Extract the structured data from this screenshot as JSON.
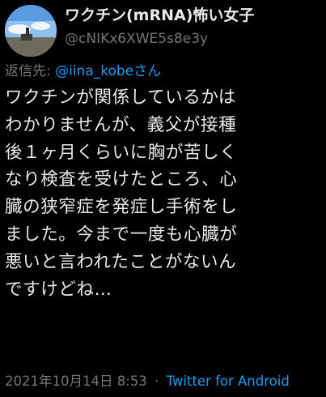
{
  "user": {
    "display_name": "ワクチン(mRNA)怖い女子",
    "handle": "@cNIKx6XWE5s8e3y"
  },
  "reply": {
    "prefix": "返信先: ",
    "mention": "@iina_kobeさん"
  },
  "tweet": {
    "lines": [
      "ワクチンが関係しているかは",
      "わかりませんが、義父が接種",
      "後１ヶ月くらいに胸が苦しく",
      "なり検査を受けたところ、心",
      "臓の狭窄症を発症し手術をし",
      "ました。今まで一度も心臓が",
      "悪いと言われたことがないん",
      "ですけどね…"
    ]
  },
  "meta": {
    "date": "2021年10月14日",
    "time": "8:53",
    "separator": "·",
    "source": "Twitter for Android"
  }
}
